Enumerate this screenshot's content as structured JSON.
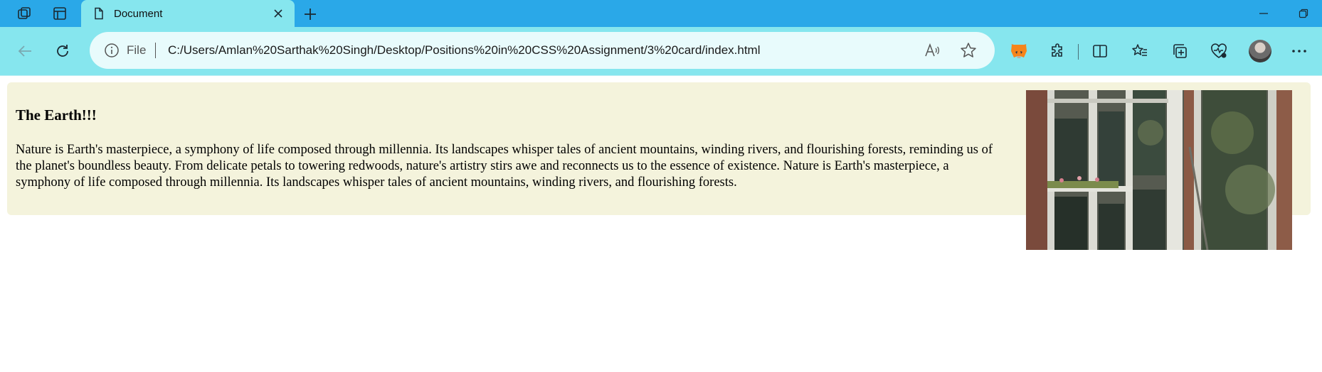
{
  "browser": {
    "tab": {
      "title": "Document",
      "icon": "page-icon"
    },
    "address": {
      "scheme_label": "File",
      "url": "C:/Users/Amlan%20Sarthak%20Singh/Desktop/Positions%20in%20CSS%20Assignment/3%20card/index.html"
    },
    "toolbar_icons": [
      "read-aloud-icon",
      "favorite-star-icon",
      "metamask-extension-icon",
      "extensions-puzzle-icon",
      "split-screen-icon",
      "favorites-icon",
      "collections-icon",
      "browser-essentials-icon",
      "profile-avatar",
      "more-menu-icon"
    ],
    "colors": {
      "titlebar": "#2aa8e8",
      "toolbar": "#86e6ee",
      "omnibox": "#e8fbfc"
    }
  },
  "card": {
    "title": "The Earth!!!",
    "text": "Nature is Earth's masterpiece, a symphony of life composed through millennia. Its landscapes whisper tales of ancient mountains, winding rivers, and flourishing forests, reminding us of the planet's boundless beauty. From delicate petals to towering redwoods, nature's artistry stirs awe and reconnects us to the essence of existence. Nature is Earth's masterpiece, a symphony of life composed through millennia. Its landscapes whisper tales of ancient mountains, winding rivers, and flourishing forests.",
    "image": "building-facade-photo",
    "background": "#f4f3dc"
  }
}
